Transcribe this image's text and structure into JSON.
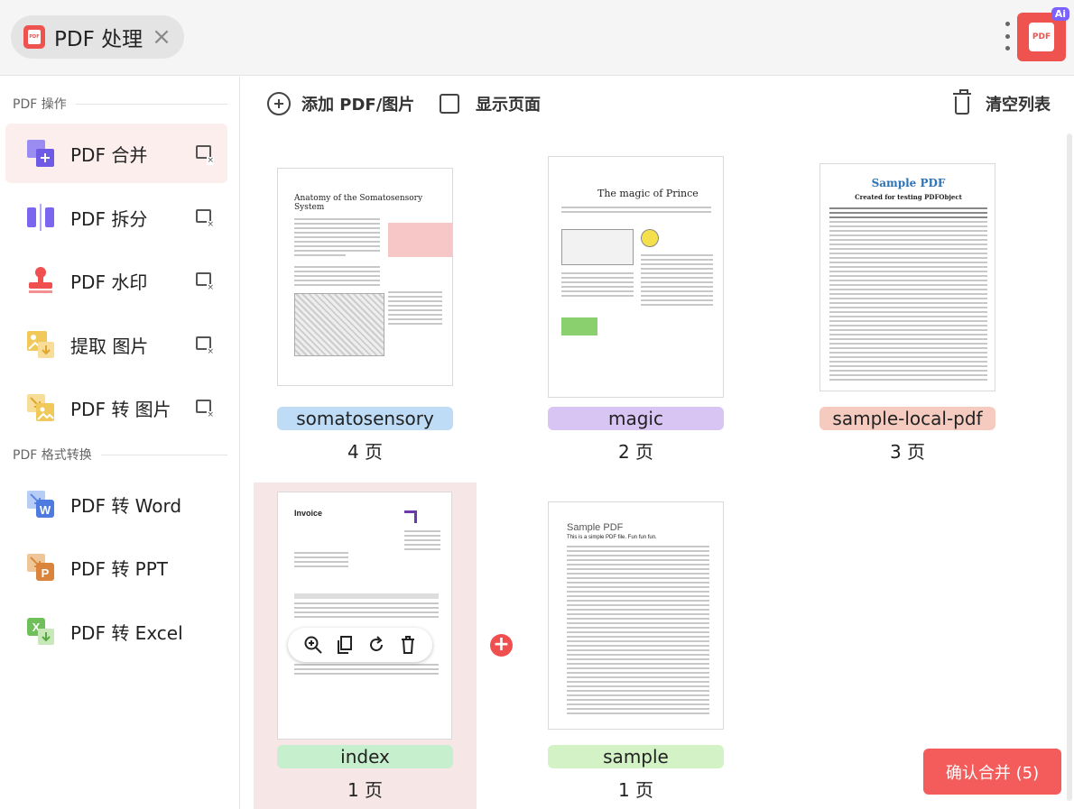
{
  "tab": {
    "title": "PDF 处理",
    "icon_name": "pdf-file-icon"
  },
  "app_logo": {
    "text": "PDF",
    "badge": "Ai"
  },
  "sidebar": {
    "sections": [
      {
        "label": "PDF 操作"
      },
      {
        "label": "PDF 格式转换"
      }
    ],
    "items": [
      {
        "label": "PDF 合并",
        "icon": "merge-icon",
        "active": true
      },
      {
        "label": "PDF 拆分",
        "icon": "split-icon"
      },
      {
        "label": "PDF 水印",
        "icon": "stamp-icon"
      },
      {
        "label": "提取 图片",
        "icon": "extract-image-icon"
      },
      {
        "label": "PDF 转 图片",
        "icon": "to-image-icon"
      },
      {
        "label": "PDF 转 Word",
        "icon": "word-icon"
      },
      {
        "label": "PDF 转 PPT",
        "icon": "ppt-icon"
      },
      {
        "label": "PDF 转 Excel",
        "icon": "excel-icon"
      }
    ]
  },
  "toolbar": {
    "add_label": "添加 PDF/图片",
    "show_pages_label": "显示页面",
    "clear_label": "清空列表"
  },
  "files": [
    {
      "name": "somatosensory",
      "pages": "4 页",
      "chip_color": "#bfdcf7",
      "thumb_title": "Anatomy of the Somatosensory System"
    },
    {
      "name": "magic",
      "pages": "2 页",
      "chip_color": "#d9c5f3",
      "thumb_title": "The magic of Prince"
    },
    {
      "name": "sample-local-pdf",
      "pages": "3 页",
      "chip_color": "#f5cbc0",
      "thumb_title": "Sample PDF",
      "thumb_subtitle": "Created for testing PDFObject"
    },
    {
      "name": "index",
      "pages": "1 页",
      "chip_color": "#c6efcd",
      "thumb_title": "Invoice"
    },
    {
      "name": "sample",
      "pages": "1 页",
      "chip_color": "#d3f2c5",
      "thumb_title": "Sample PDF",
      "thumb_subtitle": "This is a simple PDF file. Fun fun fun."
    }
  ],
  "confirm_button": "确认合并 (5)"
}
